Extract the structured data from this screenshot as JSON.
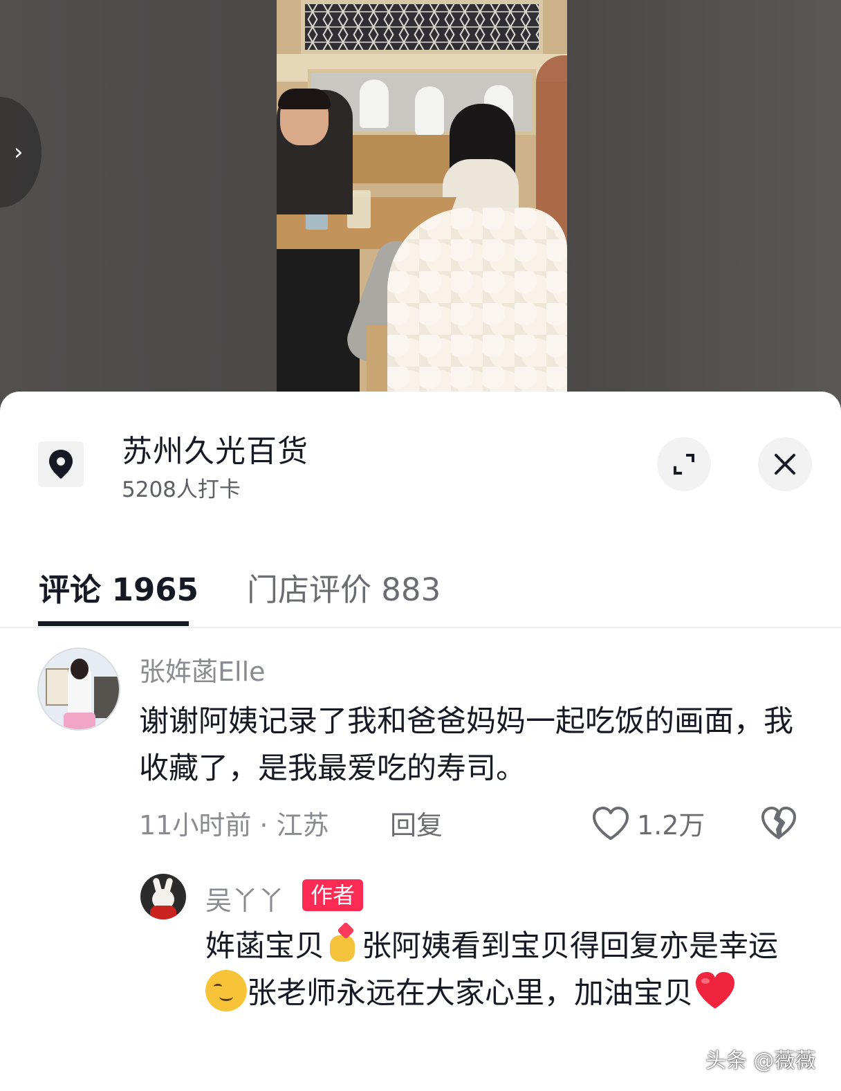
{
  "location": {
    "title": "苏州久光百货",
    "checkins": "5208人打卡"
  },
  "tabs": {
    "comments": "评论 1965",
    "store_reviews": "门店评价 883"
  },
  "comments": [
    {
      "user": "张姩菡Elle",
      "text": "谢谢阿姨记录了我和爸爸妈妈一起吃饭的画面，我收藏了，是我最爱吃的寿司。",
      "meta": "11小时前 · 江苏",
      "reply_label": "回复",
      "likes": "1.2万"
    }
  ],
  "reply": {
    "user": "吴丫丫",
    "badge": "作者",
    "text_part1": "姩菡宝贝",
    "text_part2": "张阿姨看到宝贝得回复亦是幸运",
    "text_part3": "张老师永远在大家心里，加油宝贝"
  },
  "watermark": "头条 @薇薇",
  "icons": {
    "location": "location-pin-icon",
    "expand": "expand-icon",
    "close": "close-icon",
    "like": "heart-outline-icon",
    "dislike": "broken-heart-icon",
    "nav": "chevron-right-icon"
  },
  "colors": {
    "badge": "#fe2c55",
    "text_primary": "#161823",
    "text_secondary": "#8a8b91"
  }
}
